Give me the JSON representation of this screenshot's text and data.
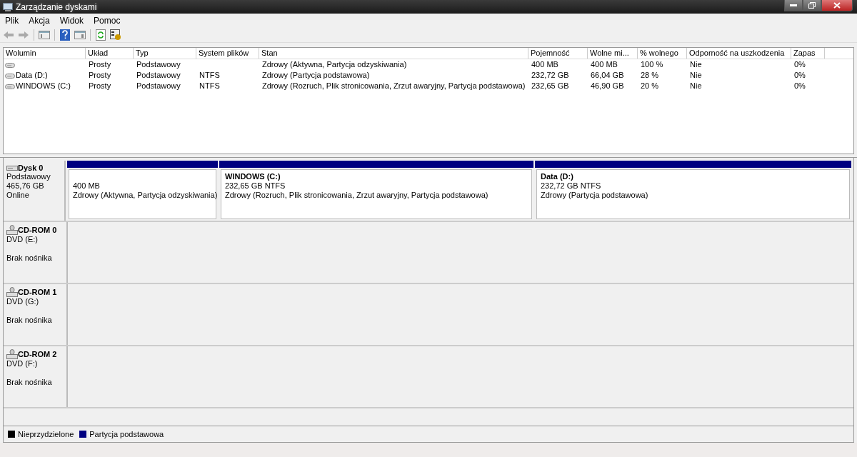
{
  "window": {
    "title": "Zarządzanie dyskami"
  },
  "menu": [
    "Plik",
    "Akcja",
    "Widok",
    "Pomoc"
  ],
  "table": {
    "columns": [
      "Wolumin",
      "Układ",
      "Typ",
      "System plików",
      "Stan",
      "Pojemność",
      "Wolne mi...",
      "% wolnego",
      "Odporność na uszkodzenia",
      "Zapas"
    ],
    "rows": [
      [
        "",
        "Prosty",
        "Podstawowy",
        "",
        "Zdrowy (Aktywna, Partycja odzyskiwania)",
        "400 MB",
        "400 MB",
        "100 %",
        "Nie",
        "0%"
      ],
      [
        "Data (D:)",
        "Prosty",
        "Podstawowy",
        "NTFS",
        "Zdrowy (Partycja podstawowa)",
        "232,72 GB",
        "66,04 GB",
        "28 %",
        "Nie",
        "0%"
      ],
      [
        "WINDOWS (C:)",
        "Prosty",
        "Podstawowy",
        "NTFS",
        "Zdrowy (Rozruch, Plik stronicowania, Zrzut awaryjny, Partycja podstawowa)",
        "232,65 GB",
        "46,90 GB",
        "20 %",
        "Nie",
        "0%"
      ]
    ]
  },
  "disks": [
    {
      "kind": "disk",
      "name": "Dysk 0",
      "subtitle": "Podstawowy",
      "size": "465,76 GB",
      "status": "Online",
      "partitions": [
        {
          "kind": "primary",
          "size": "400 MB",
          "status": "Zdrowy (Aktywna, Partycja odzyskiwania)"
        },
        {
          "kind": "primary",
          "name": "WINDOWS  (C:)",
          "size": "232,65 GB NTFS",
          "status": "Zdrowy (Rozruch, Plik stronicowania, Zrzut awaryjny, Partycja podstawowa)"
        },
        {
          "kind": "primary",
          "name": "Data  (D:)",
          "size": "232,72 GB NTFS",
          "status": "Zdrowy (Partycja podstawowa)"
        }
      ]
    },
    {
      "kind": "cdrom",
      "name": "CD-ROM 0",
      "subtitle": "DVD (E:)",
      "status": "Brak nośnika"
    },
    {
      "kind": "cdrom",
      "name": "CD-ROM 1",
      "subtitle": "DVD (G:)",
      "status": "Brak nośnika"
    },
    {
      "kind": "cdrom",
      "name": "CD-ROM 2",
      "subtitle": "DVD (F:)",
      "status": "Brak nośnika"
    }
  ],
  "legend": [
    {
      "kind": "unallocated",
      "label": "Nieprzydzielone",
      "color": "#000000"
    },
    {
      "kind": "primary",
      "label": "Partycja podstawowa",
      "color": "#000080"
    }
  ]
}
